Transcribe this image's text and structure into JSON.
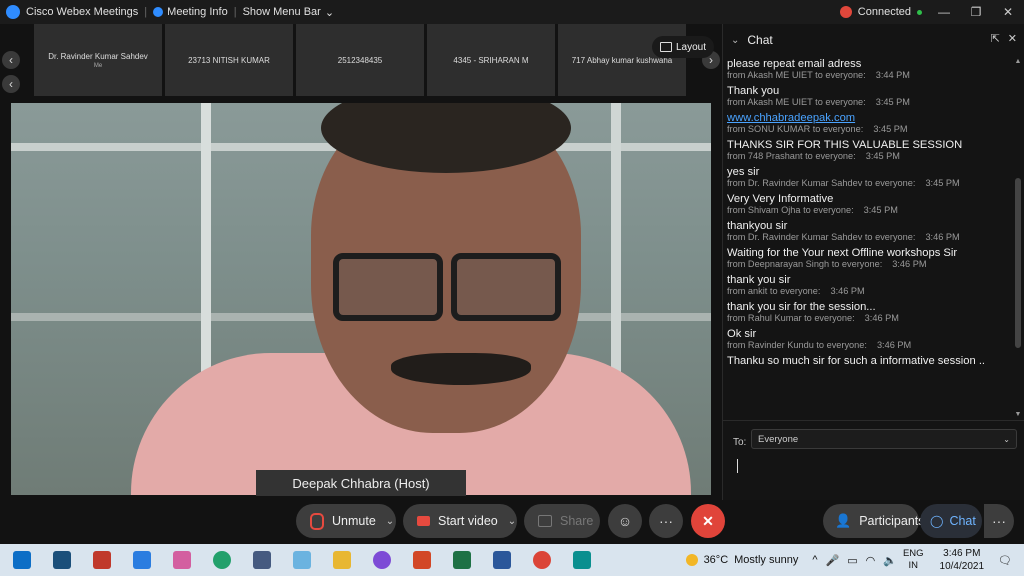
{
  "titlebar": {
    "app_name": "Cisco Webex Meetings",
    "meeting_info": "Meeting Info",
    "show_menu_bar": "Show Menu Bar",
    "status": "Connected"
  },
  "thumbnails": [
    {
      "name": "Dr. Ravinder Kumar Sahdev",
      "sub": "Me"
    },
    {
      "name": "23713 NITISH KUMAR",
      "sub": ""
    },
    {
      "name": "2512348435",
      "sub": ""
    },
    {
      "name": "4345 - SRIHARAN M",
      "sub": ""
    },
    {
      "name": "717 Abhay kumar kushwaha",
      "sub": ""
    }
  ],
  "layout_label": "Layout",
  "active_speaker": "Deepak Chhabra (Host)",
  "controls": {
    "unmute": "Unmute",
    "start_video": "Start video",
    "share": "Share",
    "participants": "Participants",
    "chat": "Chat"
  },
  "chat": {
    "title": "Chat",
    "messages": [
      {
        "text": "please repeat email adress",
        "from": "from Akash ME UIET to everyone:",
        "time": "3:44 PM"
      },
      {
        "text": "Thank you",
        "from": "from Akash ME UIET to everyone:",
        "time": "3:45 PM"
      },
      {
        "text": "www.chhabradeepak.com",
        "from": "from SONU KUMAR to everyone:",
        "time": "3:45 PM"
      },
      {
        "text": "THANKS SIR FOR THIS VALUABLE SESSION",
        "from": "from 748 Prashant to everyone:",
        "time": "3:45 PM"
      },
      {
        "text": "yes sir",
        "from": "from Dr. Ravinder Kumar Sahdev to everyone:",
        "time": "3:45 PM"
      },
      {
        "text": "Very Very Informative",
        "from": "from Shivam Ojha to everyone:",
        "time": "3:45 PM"
      },
      {
        "text": "thankyou sir",
        "from": "from Dr. Ravinder Kumar Sahdev to everyone:",
        "time": "3:46 PM"
      },
      {
        "text": "Waiting for the Your next Offline workshops Sir",
        "from": "from Deepnarayan Singh to everyone:",
        "time": "3:46 PM"
      },
      {
        "text": "thank you sir",
        "from": "from ankit to everyone:",
        "time": "3:46 PM"
      },
      {
        "text": "thank you sir for the session...",
        "from": "from Rahul Kumar  to everyone:",
        "time": "3:46 PM"
      },
      {
        "text": "Ok sir",
        "from": "from Ravinder Kundu to everyone:",
        "time": "3:46 PM"
      },
      {
        "text": "Thanku so much sir for such a informative session ..",
        "from": "",
        "time": ""
      }
    ],
    "to_label": "To:",
    "to_value": "Everyone"
  },
  "taskbar": {
    "temperature": "36°C",
    "weather": "Mostly sunny",
    "lang_line1": "ENG",
    "lang_line2": "IN",
    "time": "3:46 PM",
    "date": "10/4/2021"
  },
  "colors": {
    "accent_blue": "#2f8cff",
    "end_call_red": "#e0443a",
    "muted_red": "#e64a3f",
    "link_blue": "#4aa3ff"
  }
}
